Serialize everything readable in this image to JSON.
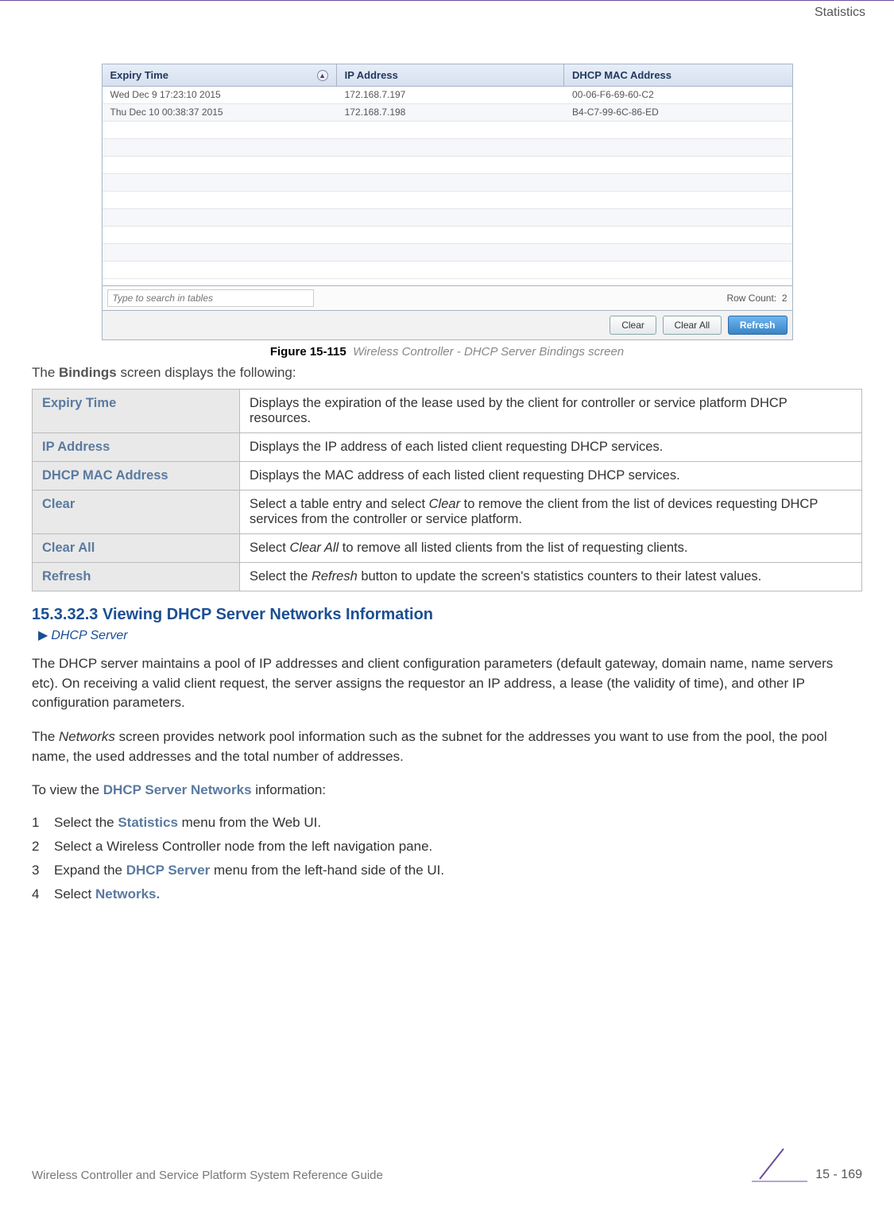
{
  "header": {
    "section": "Statistics"
  },
  "screenshot": {
    "columns": [
      "Expiry Time",
      "IP Address",
      "DHCP MAC Address"
    ],
    "rows": [
      {
        "expiry": "Wed Dec  9 17:23:10 2015",
        "ip": "172.168.7.197",
        "mac": "00-06-F6-69-60-C2"
      },
      {
        "expiry": "Thu Dec 10 00:38:37 2015",
        "ip": "172.168.7.198",
        "mac": "B4-C7-99-6C-86-ED"
      }
    ],
    "search_placeholder": "Type to search in tables",
    "row_count_label": "Row Count:",
    "row_count_value": "2",
    "buttons": {
      "clear": "Clear",
      "clear_all": "Clear All",
      "refresh": "Refresh"
    }
  },
  "figure": {
    "label": "Figure 15-115",
    "caption": "Wireless Controller - DHCP Server Bindings screen"
  },
  "intro_line": {
    "pre": "The ",
    "bold": "Bindings",
    "post": " screen displays the following:"
  },
  "info_rows": [
    {
      "label": "Expiry Time",
      "desc": "Displays the expiration of the lease used by the client for controller or service platform DHCP resources."
    },
    {
      "label": "IP Address",
      "desc": "Displays the IP address of each listed client requesting DHCP services."
    },
    {
      "label": "DHCP MAC Address",
      "desc": "Displays the MAC address of each listed client requesting DHCP services."
    },
    {
      "label": "Clear",
      "desc_pre": "Select a table entry and select ",
      "desc_em": "Clear",
      "desc_post": " to remove the client from the list of devices requesting DHCP services from the controller or service platform."
    },
    {
      "label": "Clear All",
      "desc_pre": "Select ",
      "desc_em": "Clear All",
      "desc_post": " to remove all listed clients from the list of requesting clients."
    },
    {
      "label": "Refresh",
      "desc_pre": "Select the ",
      "desc_em": "Refresh",
      "desc_post": " button to update the screen's statistics counters to their latest values."
    }
  ],
  "section_heading": "15.3.32.3  Viewing DHCP Server Networks Information",
  "breadcrumb": "DHCP Server",
  "paragraphs": {
    "p1": "The DHCP server maintains a pool of IP addresses and client configuration parameters (default gateway, domain name, name servers etc). On receiving a valid client request, the server assigns the requestor an IP address, a lease (the validity of time), and other IP configuration parameters.",
    "p2_pre": "The ",
    "p2_em": "Networks",
    "p2_post": " screen provides network pool information such as the subnet for the addresses you want to use from the pool, the pool name, the used addresses and the total number of addresses.",
    "p3_pre": "To view the ",
    "p3_bold": "DHCP Server Networks",
    "p3_post": " information:"
  },
  "steps": [
    {
      "num": "1",
      "pre": "Select the ",
      "bold": "Statistics",
      "post": " menu from the Web UI."
    },
    {
      "num": "2",
      "pre": "Select a Wireless Controller node from the left navigation pane."
    },
    {
      "num": "3",
      "pre": "Expand the ",
      "bold": "DHCP Server",
      "post": " menu from the left-hand side of the UI."
    },
    {
      "num": "4",
      "pre": "Select ",
      "bold": "Networks."
    }
  ],
  "footer": {
    "guide": "Wireless Controller and Service Platform System Reference Guide",
    "page": "15 - 169"
  }
}
